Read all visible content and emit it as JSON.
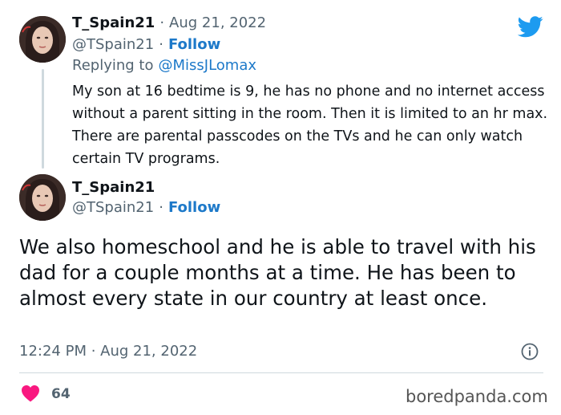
{
  "reply_tweet": {
    "display_name": "T_Spain21",
    "date": "Aug 21, 2022",
    "handle": "@TSpain21",
    "follow_label": "Follow",
    "replying_prefix": "Replying to",
    "replying_to": "@MissJLomax",
    "text": "My son at 16 bedtime is 9, he has no phone and no internet access without a parent sitting in the room. Then it is limited to an hr max.  There are parental passcodes on the TVs and he can only watch certain TV programs."
  },
  "main_tweet": {
    "display_name": "T_Spain21",
    "handle": "@TSpain21",
    "follow_label": "Follow",
    "text": "We also homeschool and he is able to travel with his dad for a couple months at a time. He has been to almost every state in our country at least once.",
    "timestamp": "12:24 PM · Aug 21, 2022",
    "like_count": "64"
  },
  "separator": "·",
  "watermark": "boredpanda.com",
  "colors": {
    "twitter_blue": "#1d9bf0",
    "follow_blue": "#1d79c9",
    "heart_red": "#f91880",
    "muted_text": "#536471"
  }
}
